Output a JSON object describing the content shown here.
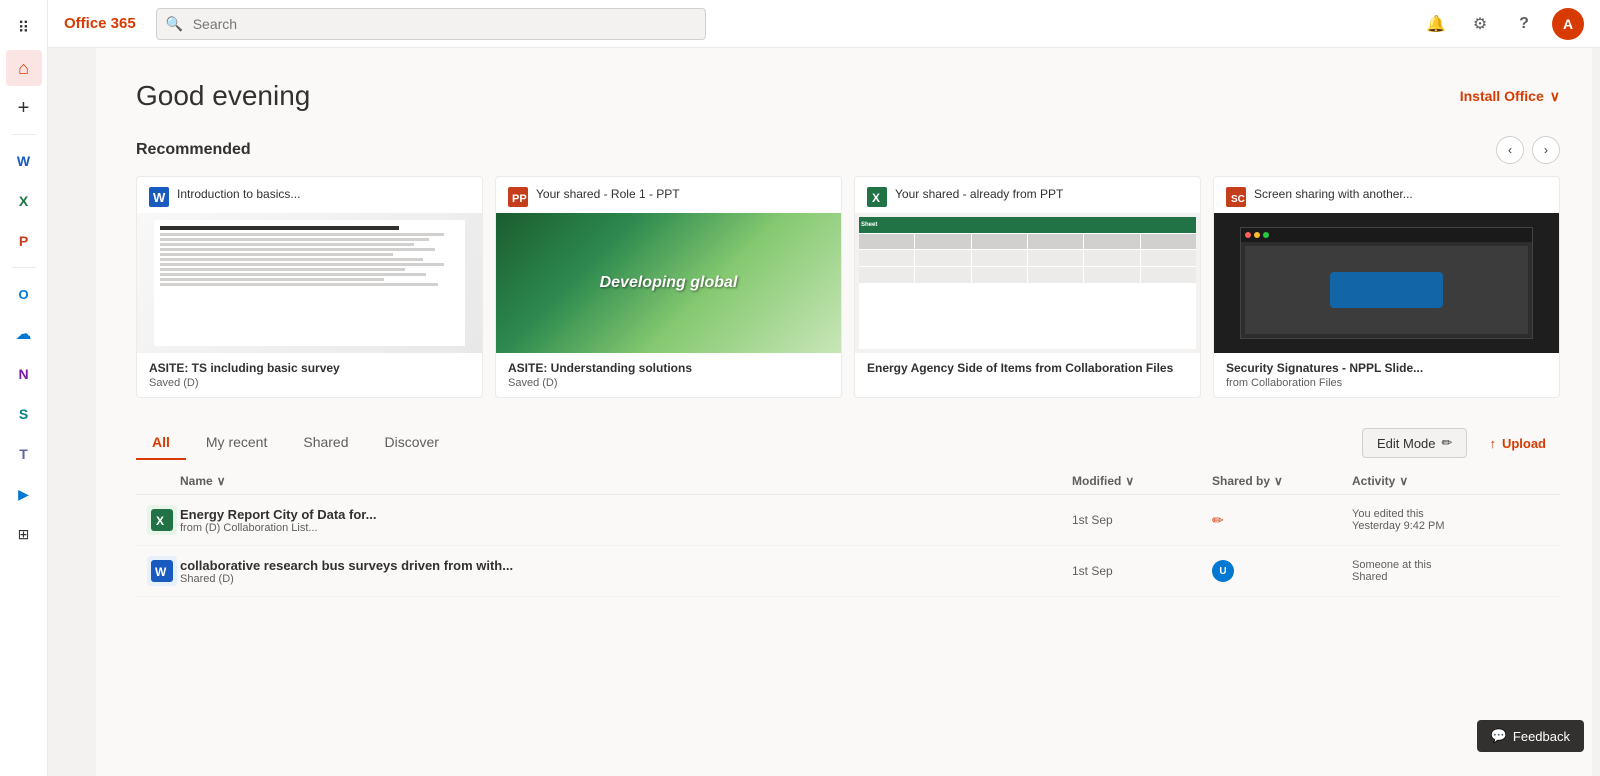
{
  "header": {
    "app_name": "Office 365",
    "search_placeholder": "Search"
  },
  "greeting": "Good evening",
  "install_office_label": "Install Office",
  "recommended_title": "Recommended",
  "nav_prev": "‹",
  "nav_next": "›",
  "recommended_cards": [
    {
      "app": "word",
      "app_color": "#185abd",
      "app_letter": "W",
      "title": "Introduction to basics...",
      "footer_title": "ASITE: TS including basic survey",
      "footer_sub": "Saved (D)",
      "thumb_type": "word"
    },
    {
      "app": "powerpoint",
      "app_color": "#c43e1c",
      "app_letter": "P",
      "title": "Your shared - Role 1 - PPT",
      "footer_title": "ASITE: Understanding solutions",
      "footer_sub": "Saved (D)",
      "thumb_type": "ppt-green"
    },
    {
      "app": "excel",
      "app_color": "#217346",
      "app_letter": "X",
      "title": "Your shared - already from PPT",
      "footer_title": "Energy Agency Side of Items from Collaboration Files",
      "footer_sub": "",
      "thumb_type": "excel"
    },
    {
      "app": "other",
      "app_color": "#c43e1c",
      "app_letter": "S",
      "title": "Screen sharing with another...",
      "footer_title": "Security Signatures - NPPL Slide...",
      "footer_sub": "from Collaboration Files",
      "thumb_type": "screen"
    }
  ],
  "tabs": [
    {
      "label": "All",
      "active": true
    },
    {
      "label": "My recent",
      "active": false
    },
    {
      "label": "Shared",
      "active": false
    },
    {
      "label": "Discover",
      "active": false
    }
  ],
  "edit_mode_label": "Edit Mode",
  "upload_label": "Upload",
  "file_list": {
    "columns": {
      "name": "Name",
      "modified": "Modified",
      "shared_by": "Shared by",
      "activity": "Activity"
    },
    "rows": [
      {
        "app": "excel",
        "app_color": "#217346",
        "app_letter": "X",
        "name": "Energy Report City of Data for...",
        "path": "from (D) Collaboration List...",
        "modified": "1st Sep",
        "shared_by": "",
        "activity_text": "You edited this",
        "activity_time": "Yesterday 9:42 PM"
      },
      {
        "app": "word",
        "app_color": "#185abd",
        "app_letter": "W",
        "name": "collaborative research bus surveys driven from with...",
        "path": "Shared (D)",
        "modified": "1st Sep",
        "shared_by": "user",
        "activity_text": "Someone at this",
        "activity_time": "Shared"
      }
    ]
  },
  "feedback_label": "Feedback",
  "icons": {
    "search": "🔍",
    "settings": "⚙",
    "help": "?",
    "notification": "🔔",
    "apps_grid": "⊞",
    "home": "⌂",
    "add": "+",
    "word": "W",
    "excel": "X",
    "powerpoint": "P",
    "outlook": "O",
    "onedrive": "☁",
    "onenote": "N",
    "sharepoint": "S",
    "teams": "T",
    "flow": "▶",
    "waffle": "⠿",
    "chevron_down": "∨",
    "edit": "✏",
    "upload_icon": "↑",
    "sort": "∨"
  }
}
